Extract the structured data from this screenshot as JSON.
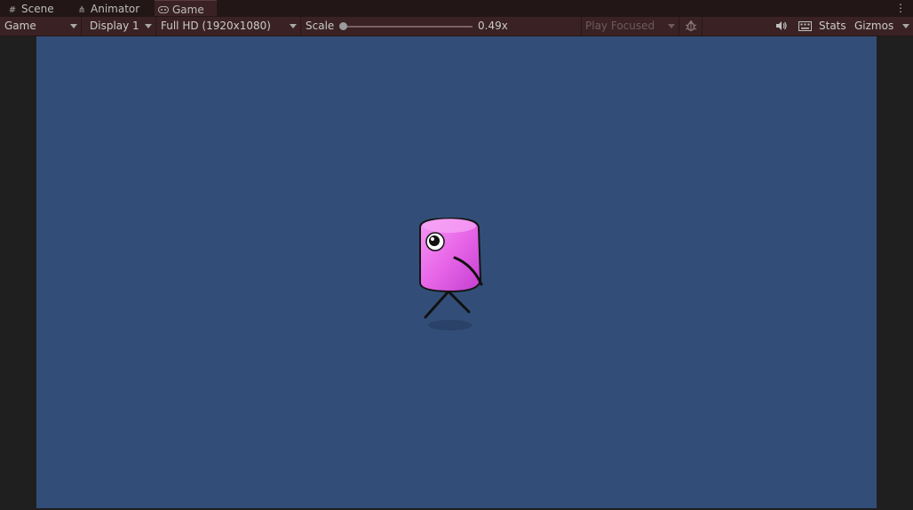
{
  "tabs": [
    {
      "label": "Scene",
      "icon": "grid-icon"
    },
    {
      "label": "Animator",
      "icon": "animator-icon"
    },
    {
      "label": "Game",
      "icon": "gamepad-icon",
      "active": true
    }
  ],
  "toolbar": {
    "game_mode": "Game",
    "display": "Display 1",
    "resolution": "Full HD (1920x1080)",
    "scale_label": "Scale",
    "scale_value": "0.49x",
    "play_mode": "Play Focused",
    "stats_label": "Stats",
    "gizmos_label": "Gizmos"
  },
  "colors": {
    "game_background": "#324e78",
    "toolbar": "#3a2224",
    "character_pink": "#e866e8"
  }
}
